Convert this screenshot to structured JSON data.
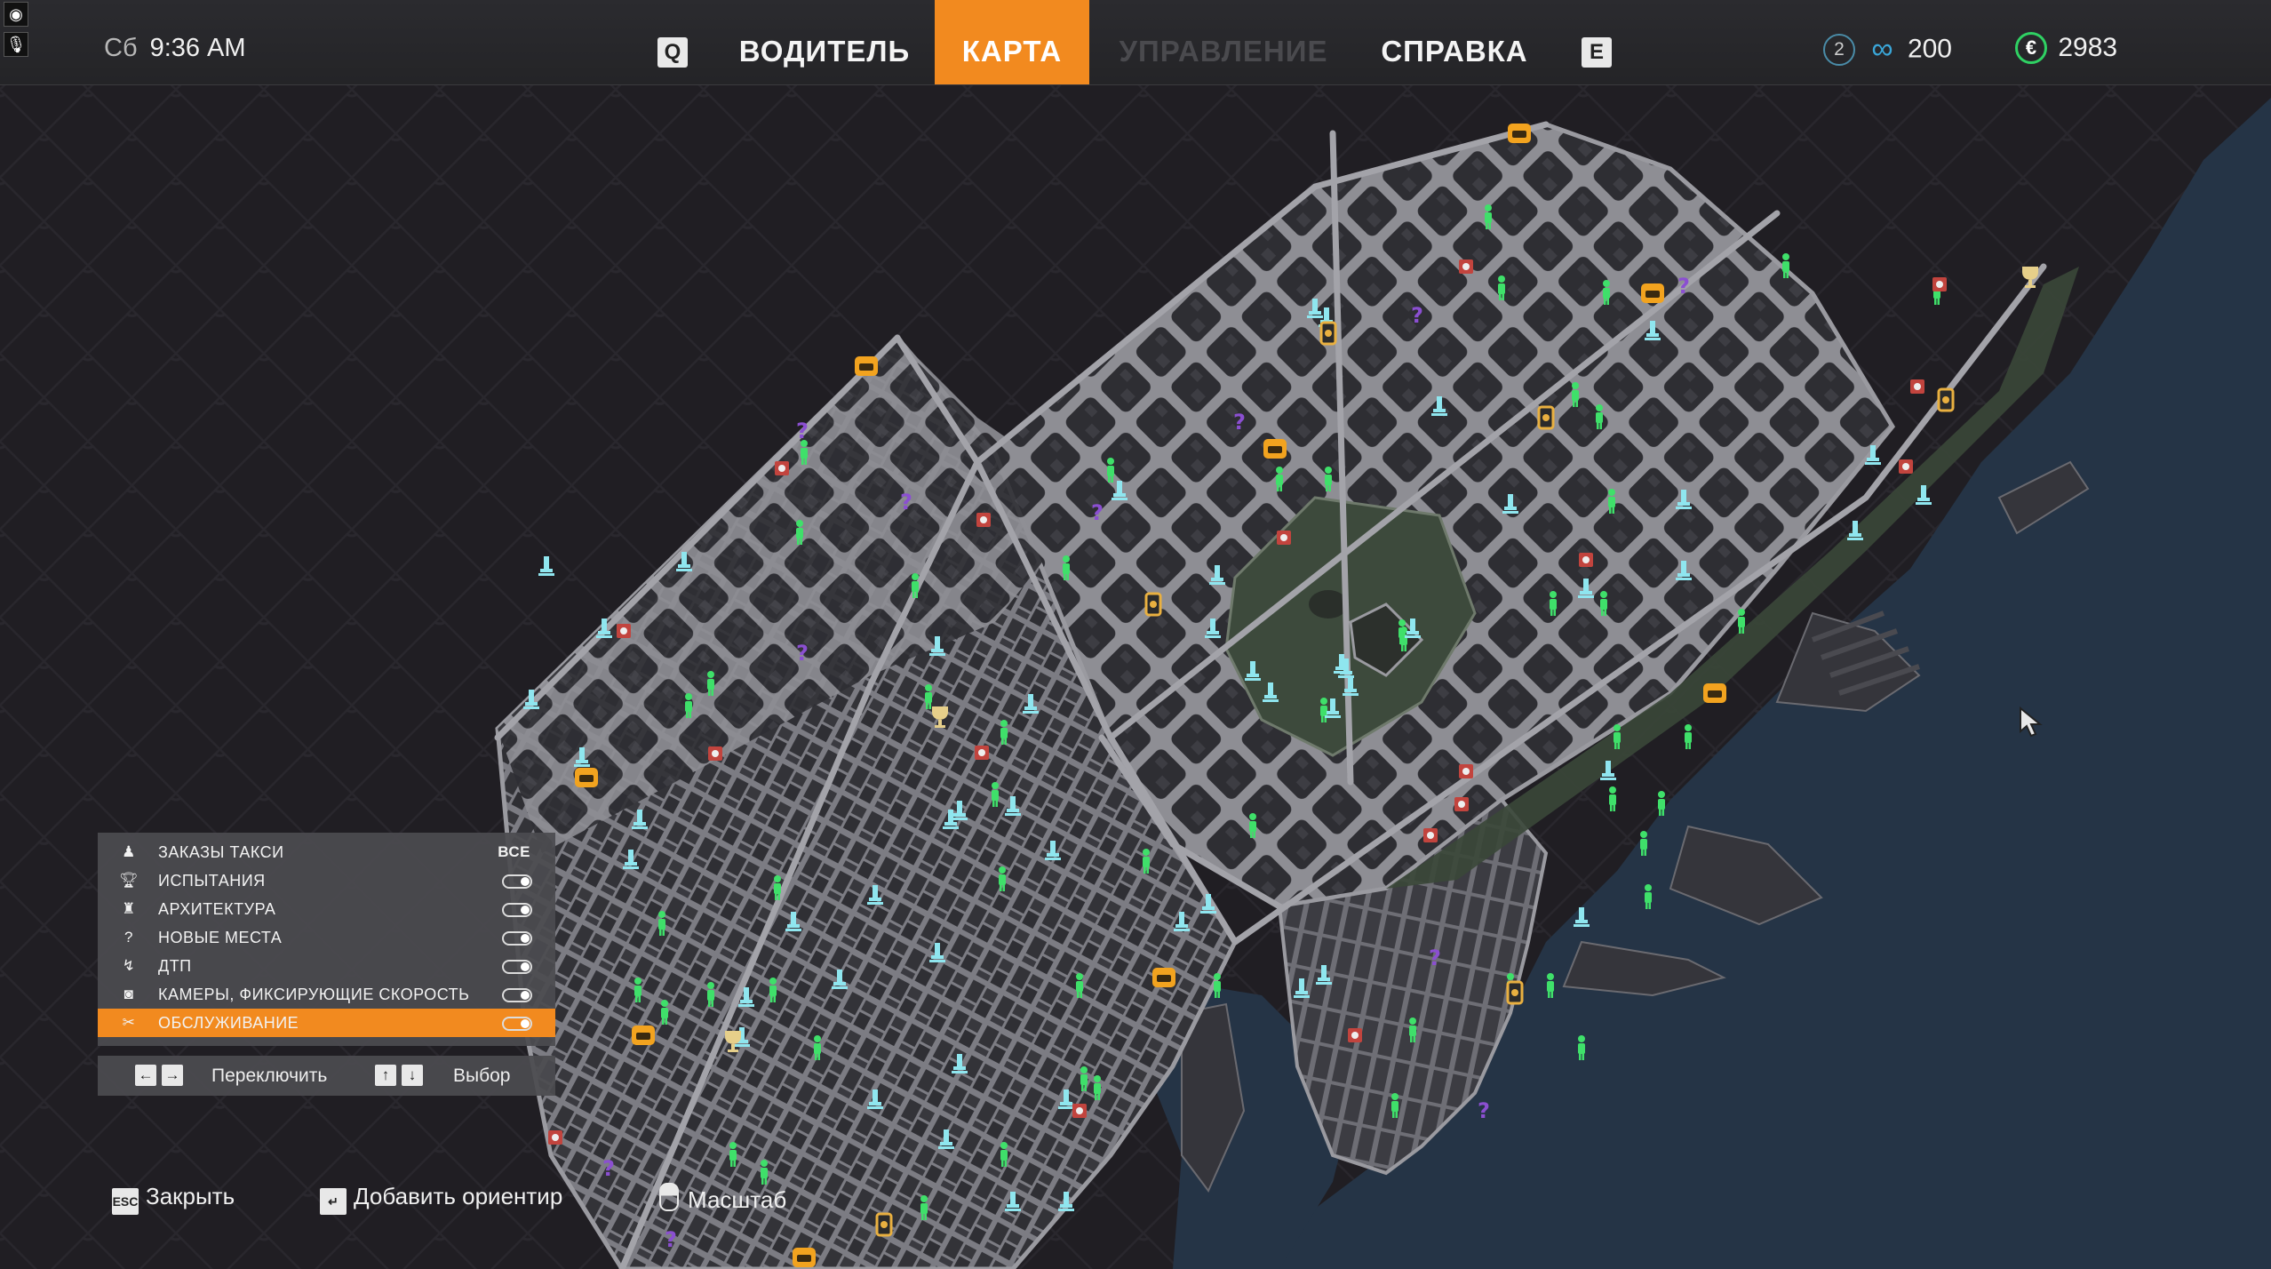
{
  "topbar": {
    "day": "Сб",
    "time": "9:36 AM",
    "key_left": "Q",
    "key_right": "E",
    "tabs": [
      {
        "label": "ВОДИТЕЛЬ",
        "state": "normal"
      },
      {
        "label": "КАРТА",
        "state": "active"
      },
      {
        "label": "УПРАВЛЕНИЕ",
        "state": "disabled"
      },
      {
        "label": "СПРАВКА",
        "state": "normal"
      }
    ],
    "level": "2",
    "points": "200",
    "money": "2983",
    "accent_color": "#f28a1f",
    "money_icon_color": "#2fd163"
  },
  "filter_panel": {
    "items": [
      {
        "icon": "passenger-icon",
        "label": "ЗАКАЗЫ ТАКСИ",
        "value": "ВСЕ"
      },
      {
        "icon": "trophy-icon",
        "label": "ИСПЫТАНИЯ",
        "value": ""
      },
      {
        "icon": "landmark-icon",
        "label": "АРХИТЕКТУРА",
        "value": ""
      },
      {
        "icon": "question-icon",
        "label": "НОВЫЕ МЕСТА",
        "value": ""
      },
      {
        "icon": "crash-icon",
        "label": "ДТП",
        "value": ""
      },
      {
        "icon": "speed-camera-icon",
        "label": "КАМЕРЫ, ФИКСИРУЮЩИЕ СКОРОСТЬ",
        "value": ""
      },
      {
        "icon": "wrench-icon",
        "label": "ОБСЛУЖИВАНИЕ",
        "value": ""
      }
    ],
    "selected_index": 6,
    "help_switch": "Переключить",
    "help_select": "Выбор"
  },
  "hints": {
    "close_key": "ESC",
    "close": "Закрыть",
    "waypoint": "Добавить ориентир",
    "zoom": "Масштаб"
  },
  "map": {
    "land_color": "#3c3c42",
    "road_color": "#8a8a90",
    "water_color": "#253446",
    "park_color": "#3d4a3c"
  }
}
